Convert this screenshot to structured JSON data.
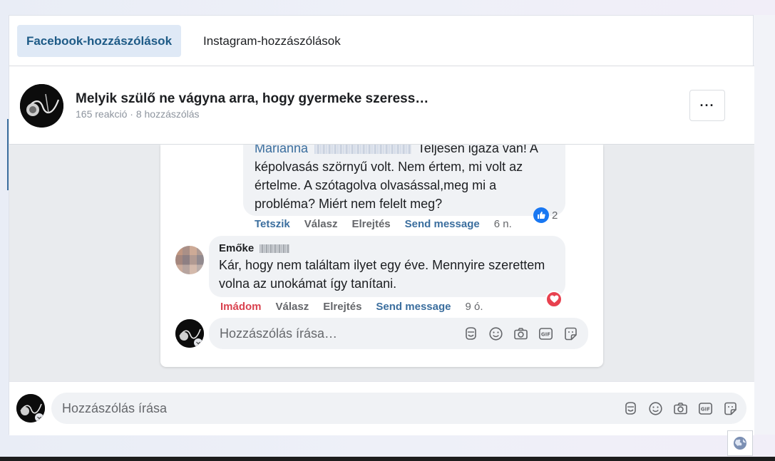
{
  "tabs": {
    "facebook": "Facebook-hozzászólások",
    "instagram": "Instagram-hozzászólások"
  },
  "post": {
    "title": "Melyik szülő ne vágyna arra, hogy gyermeke szeress…",
    "meta": "165 reakció · 8 hozzászólás",
    "more_label": "···"
  },
  "comments": [
    {
      "author": "Marianna",
      "text_first": "Teljesen igaza van! A",
      "text_rest": "képolvasás szörnyű volt. Nem értem, mi volt az értelme. A szótagolva olvasással,meg mi a probléma? Miért nem felelt meg?",
      "actions": {
        "react": "Tetszik",
        "reply": "Válasz",
        "hide": "Elrejtés",
        "send": "Send message",
        "time": "6 n."
      },
      "reaction_count": "2",
      "reaction_type": "like"
    },
    {
      "author": "Emőke",
      "text": "Kár, hogy nem találtam ilyet egy éve. Mennyire szerettem volna az unokámat így tanítani.",
      "actions": {
        "react": "Imádom",
        "reply": "Válasz",
        "hide": "Elrejtés",
        "send": "Send message",
        "time": "9 ó."
      },
      "reaction_type": "love"
    }
  ],
  "reply_input": {
    "placeholder": "Hozzászólás írása…"
  },
  "main_input": {
    "placeholder": "Hozzászólás írása"
  },
  "colors": {
    "accent": "#3b6e9e",
    "love": "#d9424f",
    "like": "#1877f2",
    "bubble": "#f0f2f5",
    "tab_active_bg": "#dfe9f6"
  }
}
